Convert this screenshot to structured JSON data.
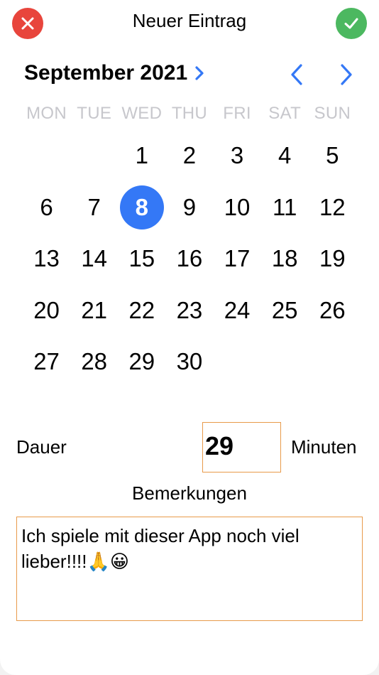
{
  "header": {
    "title": "Neuer Eintrag",
    "cancel_icon": "close-icon",
    "confirm_icon": "checkmark-icon"
  },
  "calendar": {
    "month_label": "September 2021",
    "weekdays": [
      "MON",
      "TUE",
      "WED",
      "THU",
      "FRI",
      "SAT",
      "SUN"
    ],
    "days": [
      "",
      "",
      "1",
      "2",
      "3",
      "4",
      "5",
      "6",
      "7",
      "8",
      "9",
      "10",
      "11",
      "12",
      "13",
      "14",
      "15",
      "16",
      "17",
      "18",
      "19",
      "20",
      "21",
      "22",
      "23",
      "24",
      "25",
      "26",
      "27",
      "28",
      "29",
      "30",
      "",
      "",
      ""
    ],
    "selected_day": "8",
    "accent_color": "#3478f6"
  },
  "form": {
    "duration_label": "Dauer",
    "duration_value": "29",
    "duration_unit": "Minuten",
    "notes_label": "Bemerkungen",
    "notes_value": "Ich spiele mit dieser App noch viel lieber!!!!🙏😀",
    "field_border_color": "#e89a4a"
  }
}
